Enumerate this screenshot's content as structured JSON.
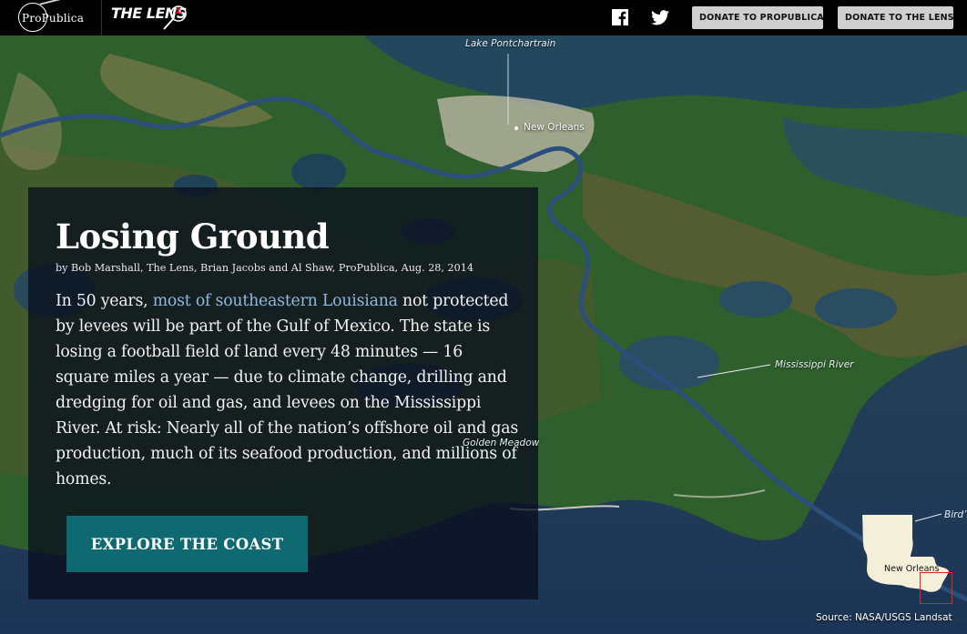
{
  "topbar": {
    "propublica_logo_text": "ProPublica",
    "lens_logo_text": "THE LENS",
    "facebook_icon": "facebook-icon",
    "twitter_icon": "twitter-icon",
    "donate_propublica_label": "DONATE TO PROPUBLICA",
    "donate_lens_label": "DONATE TO THE LENS"
  },
  "map": {
    "lake_label": "Lake Pontchartrain",
    "city_label": "New Orleans",
    "river_label": "Mississippi River",
    "golden_meadow_label": "Golden Meadow",
    "birds_foot_label": "Bird’s",
    "inset_city_label": "New Orleans",
    "source": "Source: NASA/USGS Landsat",
    "colors": {
      "water": "#1f3c58",
      "land_green": "#2f6b2a",
      "marsh": "#6d6a3a",
      "river": "#2b4f7a",
      "urban": "#b8b4a8"
    }
  },
  "story": {
    "title": "Losing Ground",
    "byline": "by Bob Marshall, The Lens, Brian Jacobs and Al Shaw, ProPublica, Aug. 28, 2014",
    "body_before_link": "In 50 years, ",
    "body_link": "most of southeastern Louisiana",
    "body_after_link": " not protected by levees will be part of the Gulf of Mexico. The state is losing a football field of land every 48 minutes — 16 square miles a year — due to climate change, drilling and dredging for oil and gas, and levees on the Mississippi River. At risk: Nearly all of the nation’s offshore oil and gas production, much of its seafood production, and millions of homes.",
    "cta_label": "EXPLORE THE COAST",
    "cta_color": "#0e6a70"
  }
}
